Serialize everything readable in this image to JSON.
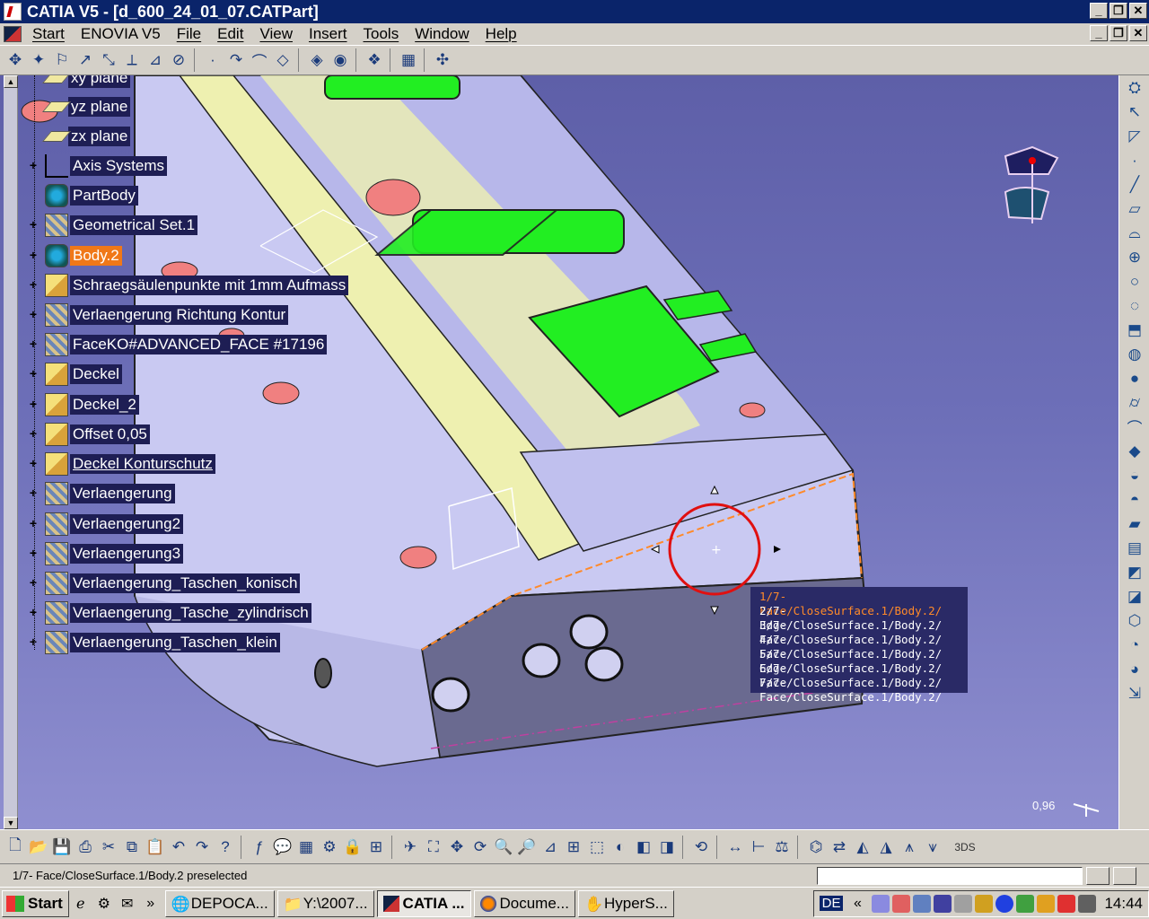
{
  "window": {
    "title": "CATIA V5 - [d_600_24_01_07.CATPart]",
    "controls": [
      "_",
      "❐",
      "✕"
    ]
  },
  "menu": {
    "items": [
      "Start",
      "ENOVIA V5",
      "File",
      "Edit",
      "View",
      "Insert",
      "Tools",
      "Window",
      "Help"
    ]
  },
  "tree": {
    "nodes": [
      {
        "label": "xy plane",
        "icon": "plane-icon"
      },
      {
        "label": "yz plane",
        "icon": "plane-icon"
      },
      {
        "label": "zx plane",
        "icon": "plane-icon"
      },
      {
        "label": "Axis Systems",
        "icon": "axis-icon"
      },
      {
        "label": "PartBody",
        "icon": "body-icon"
      },
      {
        "label": "Geometrical Set.1",
        "icon": "geoset-icon"
      },
      {
        "label": "Body.2",
        "icon": "body-icon",
        "selected": true
      },
      {
        "label": "Schraegsäulenpunkte mit 1mm Aufmass",
        "icon": "sketch-icon"
      },
      {
        "label": "Verlaengerung Richtung Kontur",
        "icon": "geoset-icon"
      },
      {
        "label": "FaceKO#ADVANCED_FACE #17196",
        "icon": "geoset-icon"
      },
      {
        "label": "Deckel",
        "icon": "sketch-icon"
      },
      {
        "label": "Deckel_2",
        "icon": "sketch-icon"
      },
      {
        "label": "Offset 0,05",
        "icon": "sketch-icon"
      },
      {
        "label": "Deckel Konturschutz",
        "icon": "sketch-icon"
      },
      {
        "label": "Verlaengerung",
        "icon": "geoset-icon"
      },
      {
        "label": "Verlaengerung2",
        "icon": "geoset-icon"
      },
      {
        "label": "Verlaengerung3",
        "icon": "geoset-icon"
      },
      {
        "label": "Verlaengerung_Taschen_konisch",
        "icon": "geoset-icon"
      },
      {
        "label": "Verlaengerung_Tasche_zylindrisch",
        "icon": "geoset-icon"
      },
      {
        "label": "Verlaengerung_Taschen_klein",
        "icon": "geoset-icon"
      }
    ]
  },
  "preselection": {
    "items": [
      "1/7-  Face/CloseSurface.1/Body.2/",
      "2/7-  Edge/CloseSurface.1/Body.2/",
      "3/7-  Face/CloseSurface.1/Body.2/",
      "4/7-  Face/CloseSurface.1/Body.2/",
      "5/7-  Edge/CloseSurface.1/Body.2/",
      "6/7-  Face/CloseSurface.1/Body.2/",
      "7/7-  Face/CloseSurface.1/Body.2/"
    ]
  },
  "viewport": {
    "zoom_readout": "0,96"
  },
  "status": {
    "message": "1/7-  Face/CloseSurface.1/Body.2 preselected"
  },
  "taskbar": {
    "start_label": "Start",
    "tasks": [
      {
        "label": "DEPOCA...",
        "icon": "globe-icon"
      },
      {
        "label": "Y:\\2007...",
        "icon": "folder-icon"
      },
      {
        "label": "CATIA ...",
        "icon": "catia-icon",
        "active": true
      },
      {
        "label": "Docume...",
        "icon": "firefox-icon"
      },
      {
        "label": "HyperS...",
        "icon": "hyper-icon"
      }
    ],
    "lang": "DE",
    "clock": "14:44"
  },
  "colors": {
    "title_bar": "#0a246a",
    "tree_label_bg": "#1e1e54",
    "tree_selected": "#f07818",
    "model_face": "#c8c8f0",
    "pocket_green": "#22ee22",
    "hole_red": "#f08080",
    "preselect_orange": "#ff8a2a"
  }
}
